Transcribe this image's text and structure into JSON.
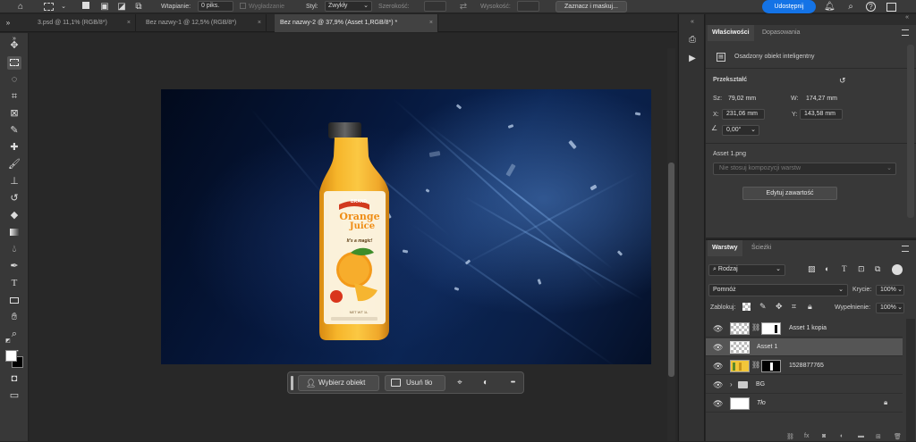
{
  "optionbar": {
    "feather_label": "Wtapianie:",
    "feather_value": "0 piks.",
    "antialias_label": "Wygładzanie",
    "style_label": "Styl:",
    "style_value": "Zwykły",
    "width_label": "Szerokość:",
    "height_label": "Wysokość:",
    "select_mask_label": "Zaznacz i maskuj...",
    "share_label": "Udostępnij"
  },
  "tabs": [
    {
      "label": "3.psd @ 11,1% (RGB/8*)",
      "close": "×"
    },
    {
      "label": "Bez nazwy-1 @ 12,5% (RGB/8*)",
      "close": "×"
    },
    {
      "label": "Bez nazwy-2 @ 37,9% (Asset 1,RGB/8*) *",
      "close": "×"
    }
  ],
  "product": {
    "brand": "BRAND",
    "title_line1": "Orange",
    "title_line2": "Juice",
    "tagline": "It's a magic!",
    "net": "NET WT 1L"
  },
  "ctxbar": {
    "select_subject": "Wybierz obiekt",
    "remove_bg": "Usuń tło",
    "more": "•••"
  },
  "properties": {
    "tab_properties": "Właściwości",
    "tab_adjustments": "Dopasowania",
    "object_type": "Osadzony obiekt inteligentny",
    "transform_heading": "Przekształć",
    "w_label": "Sz:",
    "w_value": "79,02 mm",
    "h_label": "W:",
    "h_value": "174,27 mm",
    "x_label": "X:",
    "x_value": "231,06 mm",
    "y_label": "Y:",
    "y_value": "143,58 mm",
    "angle_value": "0,00°",
    "asset_name": "Asset 1.png",
    "comp_placeholder": "Nie stosuj kompozycji warstw",
    "edit_contents": "Edytuj zawartość"
  },
  "layers": {
    "tab_layers": "Warstwy",
    "tab_paths": "Ścieżki",
    "filter_kind": "Rodzaj",
    "blend_mode": "Pomnóż",
    "opacity_label": "Krycie:",
    "opacity_value": "100%",
    "lock_label": "Zablokuj:",
    "fill_label": "Wypełnienie:",
    "fill_value": "100%",
    "items": [
      {
        "name": "Asset 1 kopia"
      },
      {
        "name": "Asset 1"
      },
      {
        "name": "1528877765"
      },
      {
        "name": "BG"
      },
      {
        "name": "Tło"
      }
    ]
  }
}
